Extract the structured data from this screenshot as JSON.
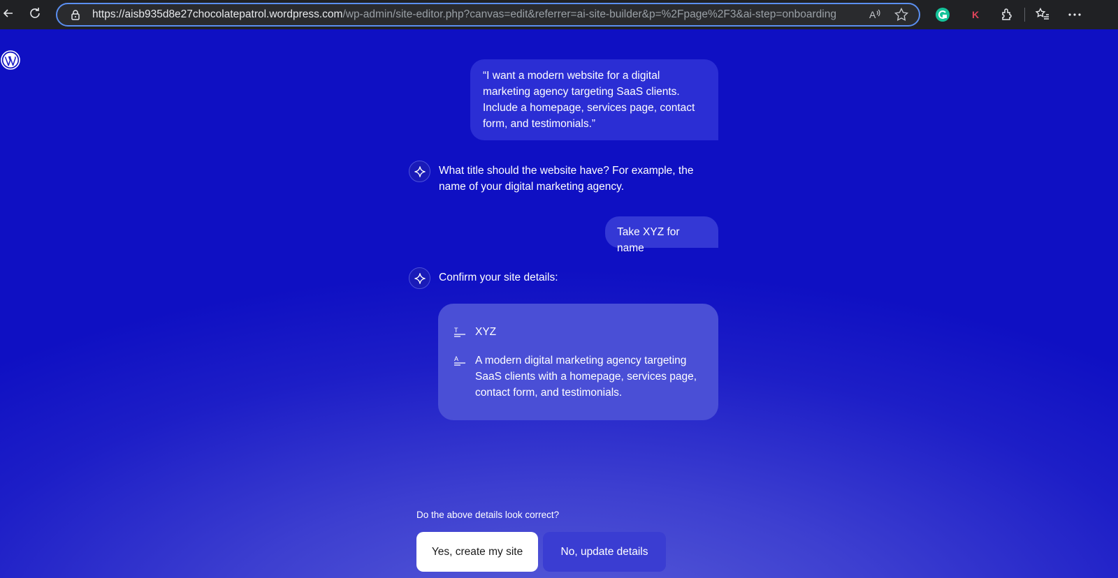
{
  "browser": {
    "url_host": "https://aisb935d8e27chocolatepatrol.wordpress.com",
    "url_path": "/wp-admin/site-editor.php?canvas=edit&referrer=ai-site-builder&p=%2Fpage%2F3&ai-step=onboarding",
    "icons": [
      "back-icon",
      "reload-icon",
      "lock-icon",
      "read-aloud-icon",
      "favorite-star-icon",
      "grammarly-extension-icon",
      "k-extension-icon",
      "extensions-puzzle-icon",
      "favorites-icon",
      "more-menu-icon"
    ],
    "read_aloud_glyph": "A",
    "k_extension_letter": "K"
  },
  "chat": {
    "user_message_1": "“I want a modern website for a digital marketing agency targeting SaaS clients. Include a homepage, services page, contact form, and testimonials.”",
    "ai_message_1": "What title should the website have? For example, the name of your digital marketing agency.",
    "user_message_2": "Take XYZ for name",
    "ai_message_2": "Confirm your site details:",
    "details": {
      "title_icon": "T",
      "title": "XYZ",
      "description_icon": "A",
      "description": "A modern digital marketing agency targeting SaaS clients with a homepage, services page, contact form, and testimonials."
    }
  },
  "confirm": {
    "question": "Do the above details look correct?",
    "yes_label": "Yes, create my site",
    "no_label": "No, update details"
  },
  "colors": {
    "background": "#1e1ec8",
    "primary_button": "#ffffff",
    "secondary_button": "#3a3dd2"
  }
}
